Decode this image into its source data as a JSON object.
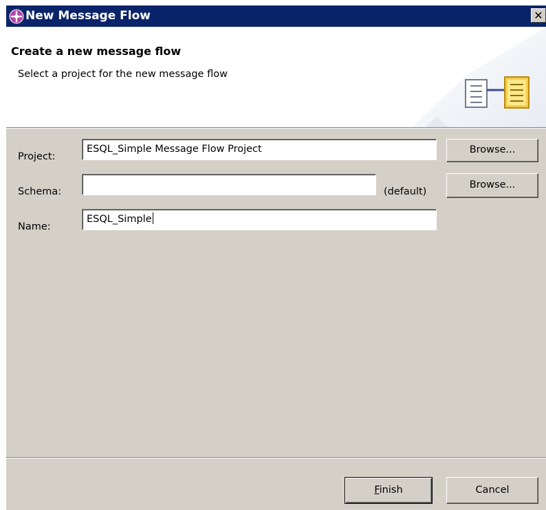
{
  "window": {
    "title": "New Message Flow",
    "close_glyph": "✕"
  },
  "header": {
    "heading": "Create a new message flow",
    "subheading": "Select a project for the new message flow",
    "wizard_icon": "message-flow-wizard-icon"
  },
  "form": {
    "project": {
      "label": "Project:",
      "value": "ESQL_Simple Message Flow Project",
      "browse_label": "Browse..."
    },
    "schema": {
      "label": "Schema:",
      "value": "",
      "default_text": "(default)",
      "browse_label": "Browse..."
    },
    "name": {
      "label": "Name:",
      "value": "ESQL_Simple"
    }
  },
  "footer": {
    "finish_mnemonic": "F",
    "finish_rest": "inish",
    "cancel_label": "Cancel"
  },
  "colors": {
    "titlebar": "#0a246a",
    "dialog_face": "#d4d0c8",
    "icon_accent": "#e8b030"
  }
}
